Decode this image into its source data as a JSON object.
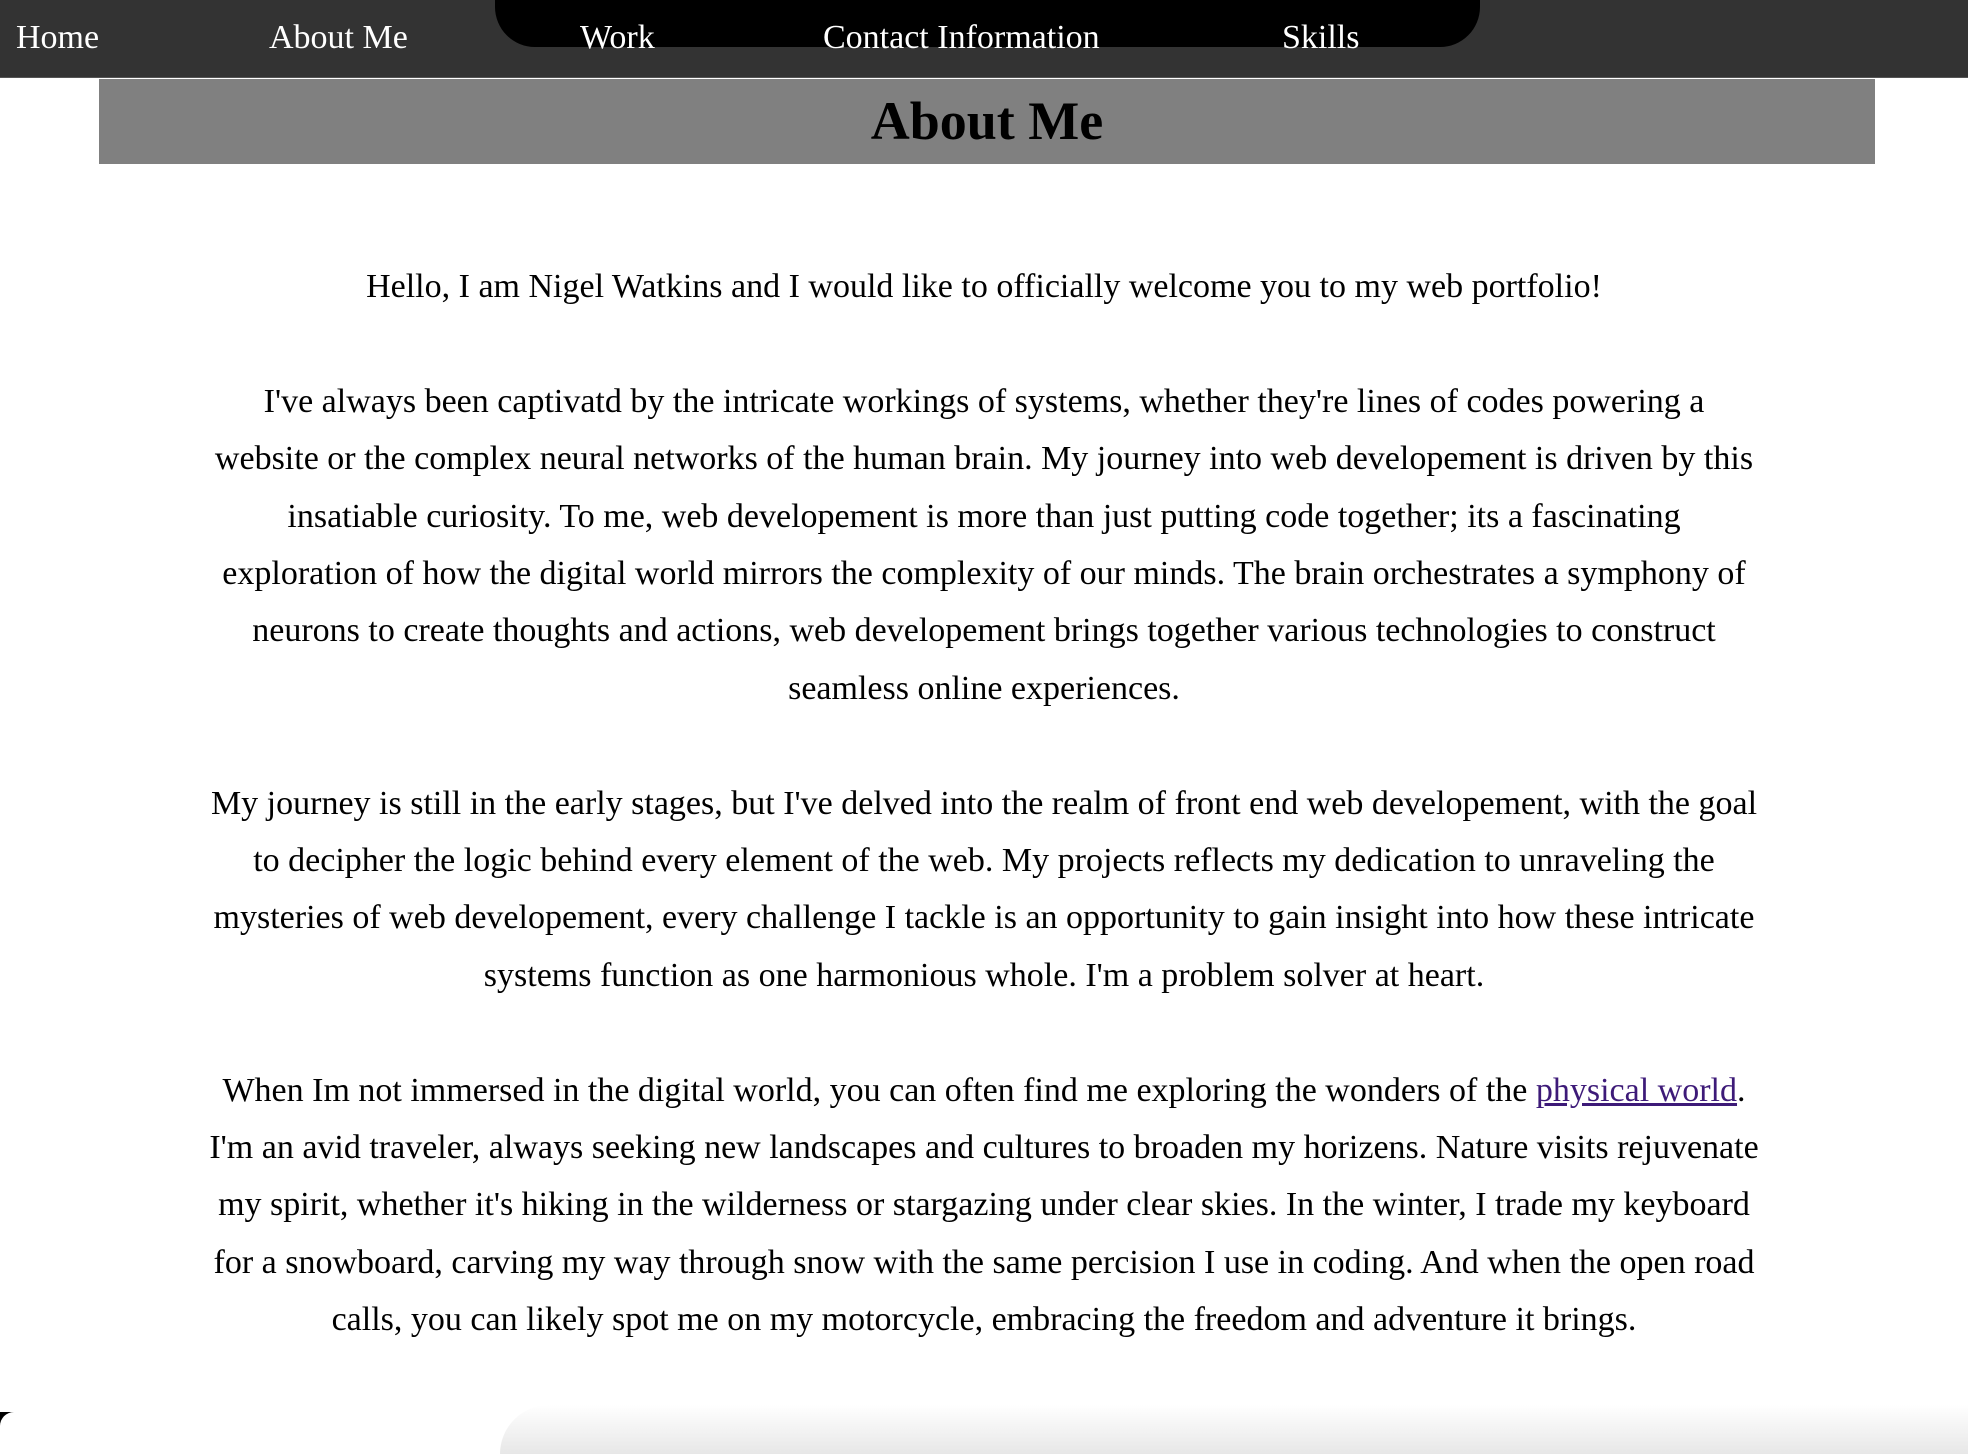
{
  "nav": {
    "items": [
      {
        "label": "Home"
      },
      {
        "label": "About Me"
      },
      {
        "label": "Work"
      },
      {
        "label": "Contact Information"
      },
      {
        "label": "Skills"
      }
    ]
  },
  "header": {
    "title": "About Me"
  },
  "content": {
    "intro": "Hello, I am Nigel Watkins and I would like to officially welcome you to my web portfolio!",
    "paragraph1": "I've always been captivatd by the intricate workings of systems, whether they're lines of codes powering a website or the complex neural networks of the human brain. My journey into web developement is driven by this insatiable curiosity. To me, web developement is more than just putting code together; its a fascinating exploration of how the digital world mirrors the complexity of our minds. The brain orchestrates a symphony of neurons to create thoughts and actions, web developement brings together various technologies to construct seamless online experiences.",
    "paragraph2": "My journey is still in the early stages, but I've delved into the realm of front end web developement, with the goal to decipher the logic behind every element of the web. My projects reflects my dedication to unraveling the mysteries of web developement, every challenge I tackle is an opportunity to gain insight into how these intricate systems function as one harmonious whole. I'm a problem solver at heart.",
    "paragraph3": {
      "before": "When Im not immersed in the digital world, you can often find me exploring the wonders of the ",
      "link": "physical world",
      "after": ". I'm an avid traveler, always seeking new landscapes and cultures to broaden my horizens. Nature visits rejuvenate my spirit, whether it's hiking in the wilderness or stargazing under clear skies. In the winter, I trade my keyboard for a snowboard, carving my way through snow with the same percision I use in coding. And when the open road calls, you can likely spot me on my motorcycle, embracing the freedom and adventure it brings."
    }
  },
  "colors": {
    "navbar": "#333333",
    "nav_pill": "#000000",
    "header_band": "#808080",
    "link_visited": "#3d1a78"
  }
}
